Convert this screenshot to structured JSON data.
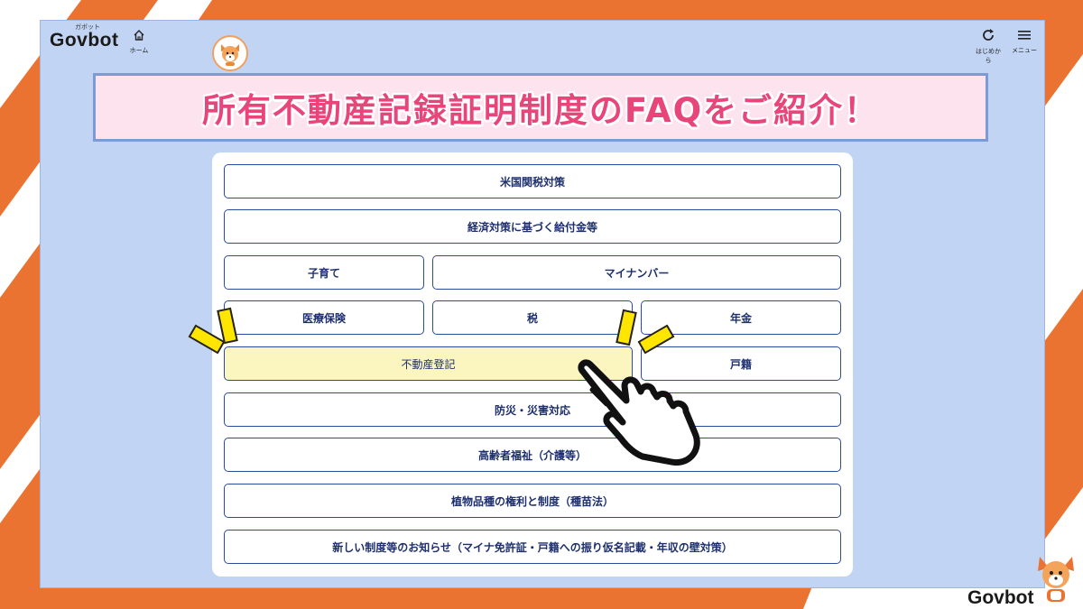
{
  "app": {
    "logo": "Govbot",
    "logo_ruby": "ガボット",
    "home_label": "ホーム",
    "restart_label": "はじめから",
    "menu_label": "メニュー",
    "home_icon": "home-icon",
    "restart_icon": "refresh-icon",
    "menu_icon": "hamburger-icon"
  },
  "headline": "所有不動産記録証明制度のFAQをご紹介！",
  "colors": {
    "accent_orange": "#ea7332",
    "frame_blue": "#c2d4f4",
    "headline_pink": "#e8457b",
    "button_border": "#2a4a9a",
    "highlight_yellow": "#fbf6c0"
  },
  "categories": [
    {
      "label": "米国関税対策"
    },
    {
      "label": "経済対策に基づく給付金等"
    },
    {
      "label": "子育て"
    },
    {
      "label": "マイナンバー"
    },
    {
      "label": "医療保険"
    },
    {
      "label": "税"
    },
    {
      "label": "年金"
    },
    {
      "label": "不動産登記",
      "highlighted": true
    },
    {
      "label": "戸籍"
    },
    {
      "label": "防災・災害対応"
    },
    {
      "label": "高齢者福祉（介護等）"
    },
    {
      "label": "植物品種の権利と制度（種苗法）"
    },
    {
      "label": "新しい制度等のお知らせ（マイナ免許証・戸籍への振り仮名記載・年収の壁対策）"
    }
  ],
  "footer": {
    "brand": "Govbot",
    "mascot_icon": "fox-mascot-icon"
  },
  "pointer_icon": "pointing-hand-icon"
}
